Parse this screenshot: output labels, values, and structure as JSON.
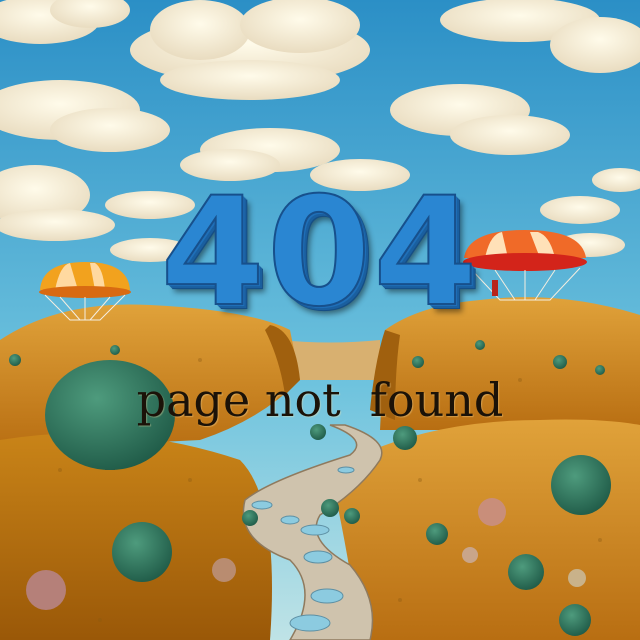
{
  "error": {
    "code": "404",
    "message": "page not  found"
  },
  "colors": {
    "sky": "#3aa3d2",
    "hills": "#d08a1c",
    "code_text": "#2a86d2",
    "message_text": "#1b1208"
  },
  "illustration": {
    "subject": "surreal landscape with rolling golden hills, a winding stone path, round green bushes, two striped parachute balloons and a cloudy blue sky"
  }
}
